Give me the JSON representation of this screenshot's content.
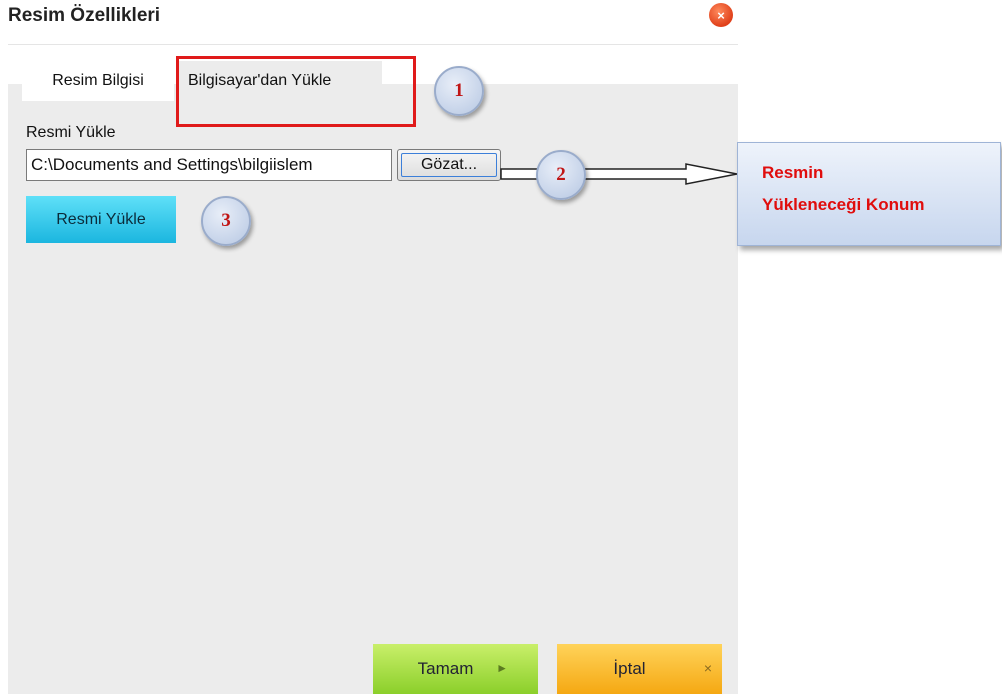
{
  "dialog": {
    "title": "Resim Özellikleri",
    "close_icon": "×"
  },
  "tabs": [
    {
      "label": "Resim Bilgisi"
    },
    {
      "label": "Bilgisayar'dan Yükle"
    }
  ],
  "upload": {
    "label": "Resmi Yükle",
    "path_value": "C:\\Documents and Settings\\bilgiislem",
    "browse_label": "Gözat...",
    "upload_button_label": "Resmi Yükle"
  },
  "annotations": {
    "badges": [
      "1",
      "2",
      "3"
    ],
    "callout_line1": "Resmin",
    "callout_line2": "Yükleneceği Konum",
    "badge_text_color": "#c01515",
    "callout_text_color": "#e00d0d",
    "highlight_color": "#e01a1a"
  },
  "footer": {
    "ok_label": "Tamam",
    "ok_icon": "►",
    "cancel_label": "İptal",
    "cancel_icon": "×"
  }
}
